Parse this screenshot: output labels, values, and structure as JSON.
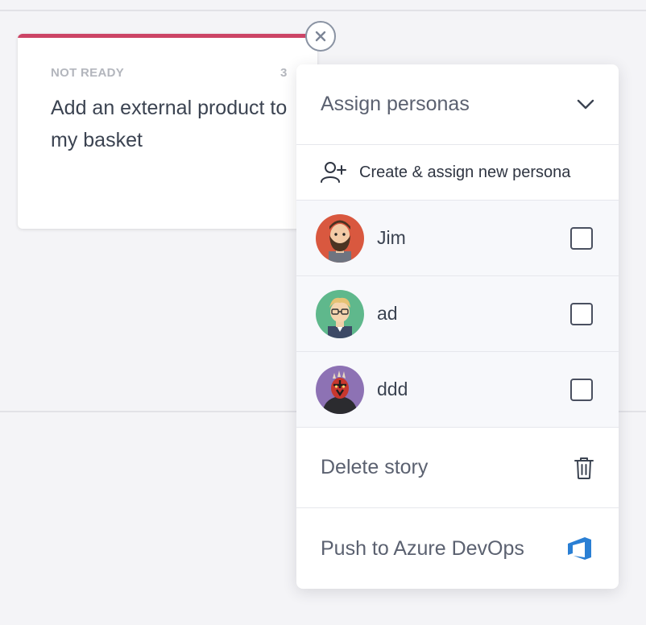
{
  "story": {
    "status": "NOT READY",
    "points": "3",
    "title": "Add an external product to my basket",
    "accent_color": "#cc4466"
  },
  "close_button": {
    "icon": "close-icon"
  },
  "menu": {
    "assign_label": "Assign personas",
    "assign_icon": "chevron-down-icon",
    "create_label": "Create & assign new persona",
    "create_icon": "add-user-icon",
    "personas": [
      {
        "name": "Jim",
        "avatar": "bearded-man-avatar",
        "checked": false
      },
      {
        "name": "ad",
        "avatar": "glasses-man-avatar",
        "checked": false
      },
      {
        "name": "ddd",
        "avatar": "sith-avatar",
        "checked": false
      }
    ],
    "delete_label": "Delete story",
    "delete_icon": "trash-icon",
    "push_label": "Push to Azure DevOps",
    "push_icon": "azure-devops-icon",
    "azure_color": "#2a7fd4"
  }
}
